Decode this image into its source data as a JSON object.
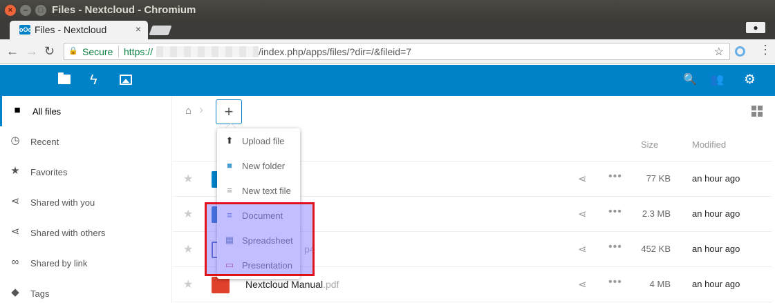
{
  "window": {
    "title": "Files - Nextcloud - Chromium",
    "close_glyph": "×",
    "minimize_glyph": "–",
    "maximize_glyph": "□"
  },
  "browser": {
    "tab_title": "Files - Nextcloud",
    "tab_favicon": "oOo",
    "tab_close": "×",
    "secure_label": "Secure",
    "url_scheme": "https://",
    "url_path": "/index.php/apps/files/?dir=/&fileid=7",
    "back_glyph": "←",
    "forward_glyph": "→",
    "reload_glyph": "↻",
    "star_glyph": "☆",
    "menu_glyph": "⋮",
    "profile_glyph": "●"
  },
  "header": {
    "apps": [
      "files-icon",
      "activity-icon",
      "gallery-icon"
    ],
    "right_icons": [
      "search-icon",
      "contacts-icon",
      "settings-icon"
    ],
    "activity_glyph": "ϟ",
    "search_glyph": "🔍",
    "contacts_glyph": "👥",
    "settings_glyph": "⚙",
    "accent_color": "#0082c9"
  },
  "sidebar": {
    "items": [
      {
        "label": "All files",
        "icon": "folder-icon",
        "glyph": "■"
      },
      {
        "label": "Recent",
        "icon": "clock-icon",
        "glyph": "◷"
      },
      {
        "label": "Favorites",
        "icon": "star-icon",
        "glyph": "★"
      },
      {
        "label": "Shared with you",
        "icon": "share-icon",
        "glyph": "⋖"
      },
      {
        "label": "Shared with others",
        "icon": "share-icon",
        "glyph": "⋖"
      },
      {
        "label": "Shared by link",
        "icon": "link-icon",
        "glyph": "∞"
      },
      {
        "label": "Tags",
        "icon": "tag-icon",
        "glyph": "◆"
      }
    ]
  },
  "main": {
    "home_glyph": "⌂",
    "crumb_sep": "›",
    "add_label": "+",
    "columns": {
      "size": "Size",
      "modified": "Modified"
    },
    "share_glyph": "⋖",
    "more_glyph": "•••",
    "star_glyph": "★",
    "rows": [
      {
        "name": "",
        "ext": "",
        "size": "77 KB",
        "modified": "an hour ago",
        "thumb_color": "#0082c9"
      },
      {
        "name": "",
        "ext": "",
        "size": "2.3 MB",
        "modified": "an hour ago",
        "thumb_color": "#1a6fc4"
      },
      {
        "name": "",
        "ext": "p4",
        "size": "452 KB",
        "modified": "an hour ago",
        "thumb_color": "#4a64b0"
      },
      {
        "name": "Nextcloud Manual",
        "ext": ".pdf",
        "size": "4 MB",
        "modified": "an hour ago",
        "thumb_color": "#e0412d"
      }
    ]
  },
  "new_menu": {
    "items": [
      {
        "label": "Upload file",
        "icon": "upload-icon",
        "glyph": "⬆",
        "color": "#333"
      },
      {
        "label": "New folder",
        "icon": "folder-icon",
        "glyph": "■",
        "color": "#4c9ed9"
      },
      {
        "label": "New text file",
        "icon": "text-file-icon",
        "glyph": "≡",
        "color": "#999"
      },
      {
        "label": "Document",
        "icon": "document-icon",
        "glyph": "≡",
        "color": "#4a6fd8"
      },
      {
        "label": "Spreadsheet",
        "icon": "spreadsheet-icon",
        "glyph": "▦",
        "color": "#6b86b0"
      },
      {
        "label": "Presentation",
        "icon": "presentation-icon",
        "glyph": "▭",
        "color": "#c04a7a"
      }
    ]
  }
}
